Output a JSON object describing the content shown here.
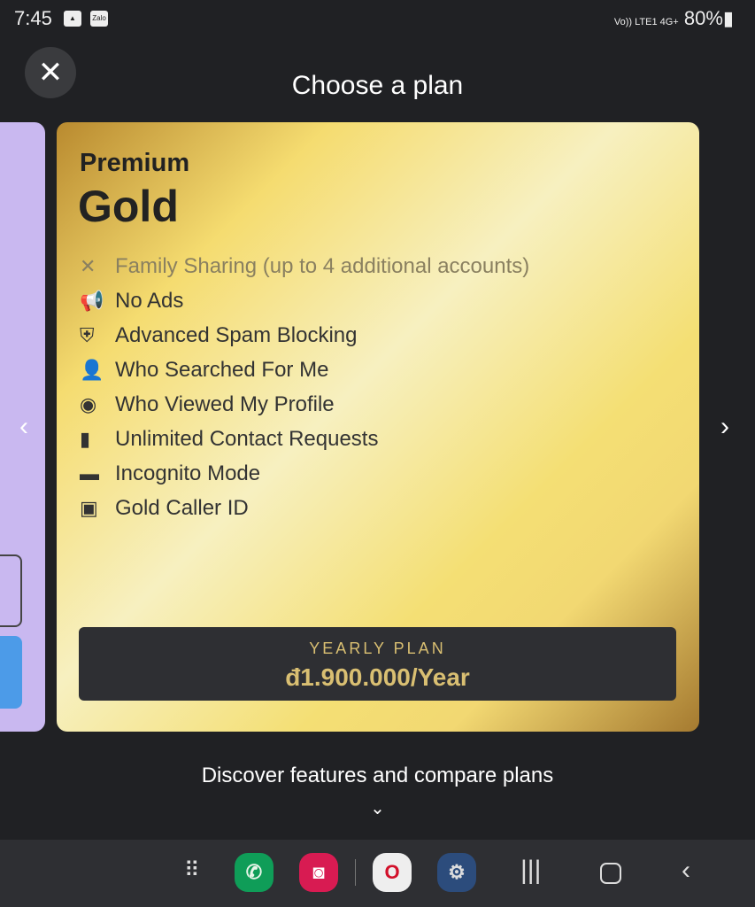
{
  "status": {
    "time": "7:45",
    "notif_icons": [
      "gallery-icon",
      "zalo-icon"
    ],
    "zalo_label": "Zalo",
    "signal_text": "Vo)) LTE1 4G+",
    "battery": "80%"
  },
  "header": {
    "title": "Choose a plan"
  },
  "card": {
    "tier": "Premium",
    "name": "Gold",
    "features": [
      {
        "icon": "x-icon",
        "label": "Family Sharing (up to 4 additional accounts)",
        "included": false
      },
      {
        "icon": "megaphone-off-icon",
        "label": "No Ads",
        "included": true
      },
      {
        "icon": "shield-check-icon",
        "label": "Advanced Spam Blocking",
        "included": true
      },
      {
        "icon": "person-search-icon",
        "label": "Who Searched For Me",
        "included": true
      },
      {
        "icon": "eye-icon",
        "label": "Who Viewed My Profile",
        "included": true
      },
      {
        "icon": "contact-doc-icon",
        "label": "Unlimited Contact Requests",
        "included": true
      },
      {
        "icon": "incognito-icon",
        "label": "Incognito Mode",
        "included": true
      },
      {
        "icon": "caller-id-icon",
        "label": "Gold Caller ID",
        "included": true
      }
    ],
    "plan_label": "YEARLY PLAN",
    "price": "đ1.900.000/Year"
  },
  "footer": {
    "discover": "Discover features and compare plans"
  },
  "colors": {
    "gold_text": "#d9bf72",
    "background": "#202124",
    "prev_card": "#c9b8f0"
  }
}
